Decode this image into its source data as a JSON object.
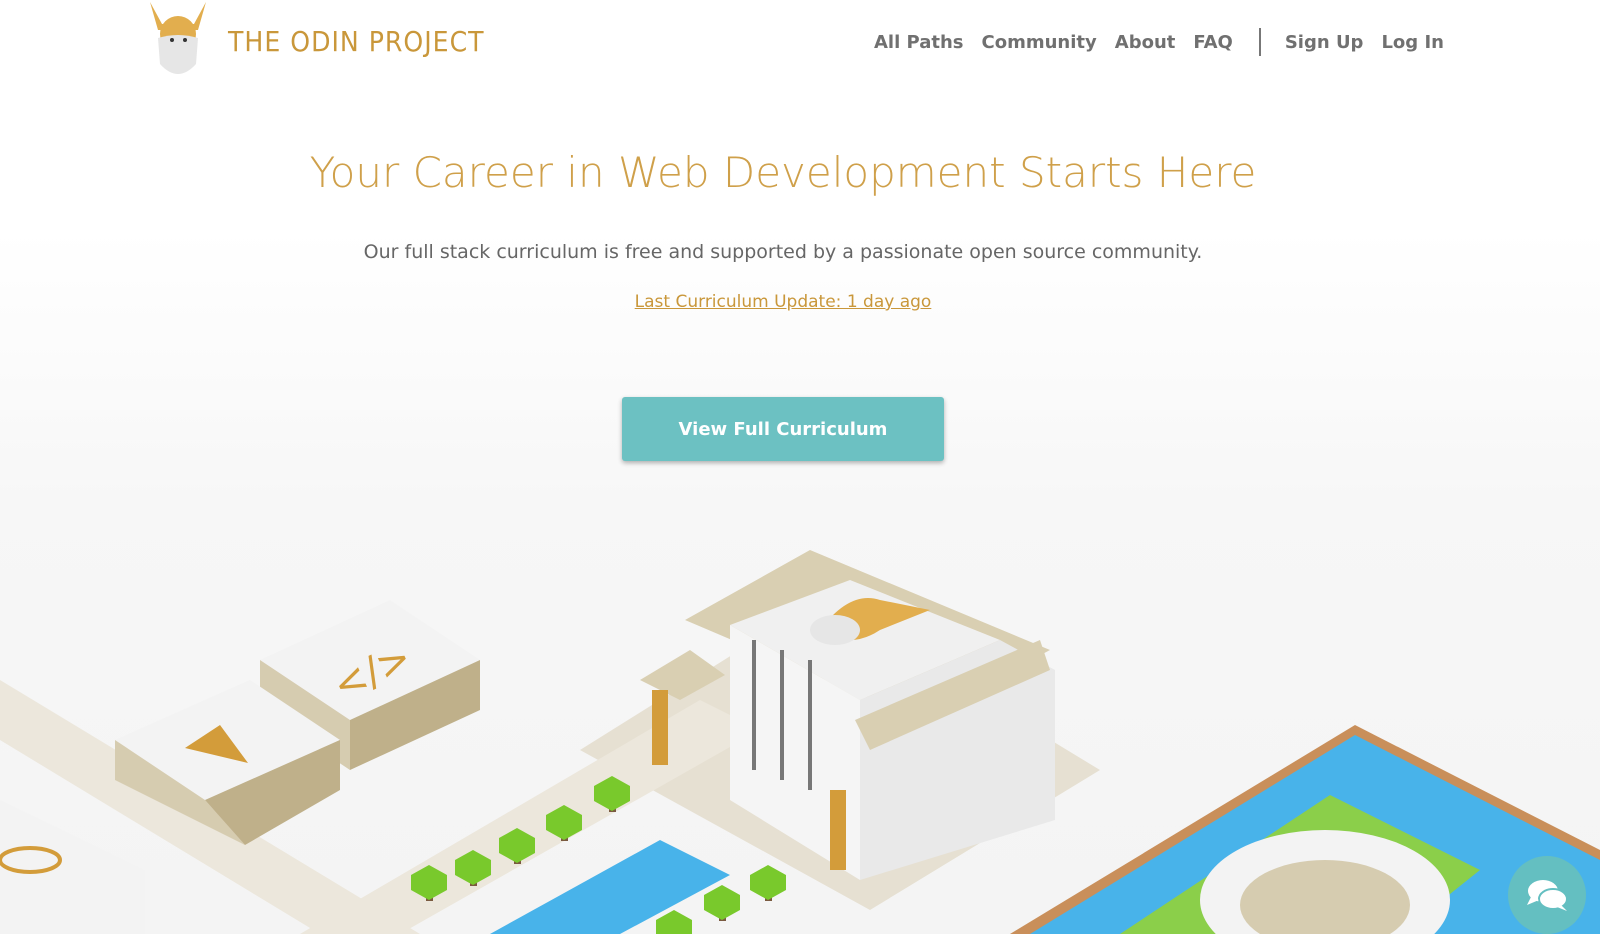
{
  "header": {
    "logo_text": "THE ODIN PROJECT",
    "nav": [
      "All Paths",
      "Community",
      "About",
      "FAQ"
    ],
    "auth": [
      "Sign Up",
      "Log In"
    ]
  },
  "hero": {
    "title": "Your Career in Web Development Starts Here",
    "subtitle": "Our full stack curriculum is free and supported by a passionate open source community.",
    "update_link": "Last Curriculum Update: 1 day ago",
    "cta": "View Full Curriculum"
  },
  "colors": {
    "brand": "#cfa04a",
    "accent": "#6cc1c2"
  },
  "icons": {
    "chat": "chat-bubbles-icon"
  }
}
